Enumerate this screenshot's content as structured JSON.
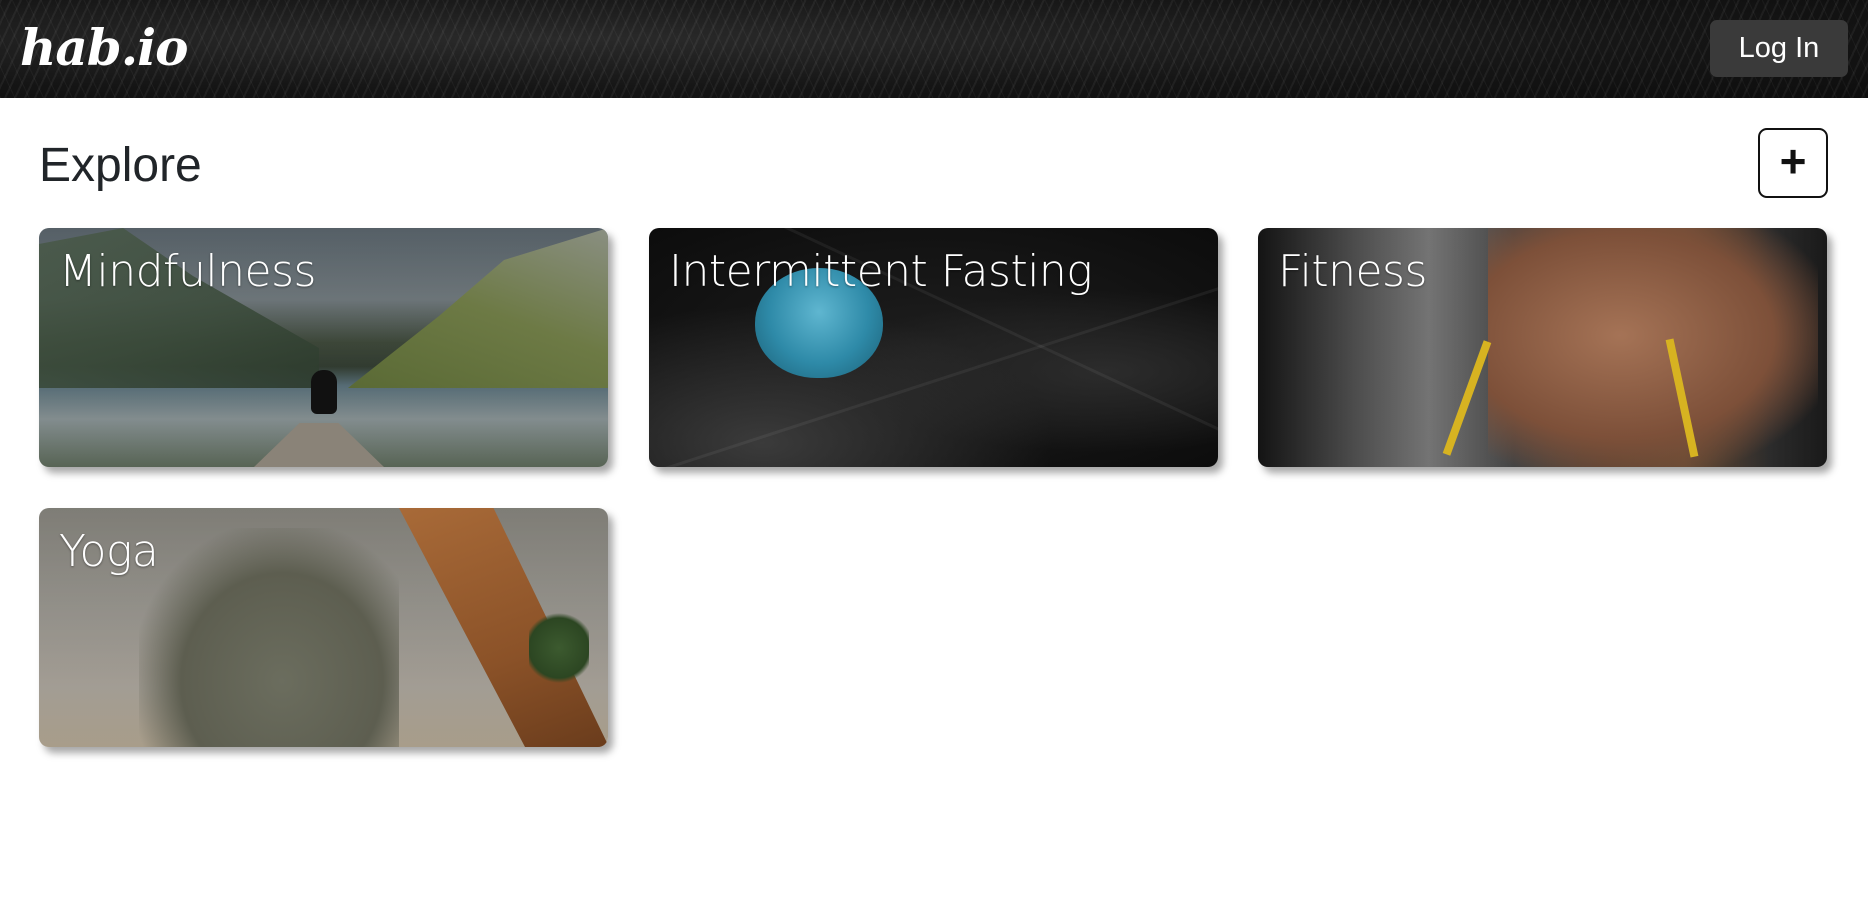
{
  "header": {
    "logo_text": "hab.io",
    "login_label": "Log In"
  },
  "main": {
    "title": "Explore",
    "add_label": "+",
    "cards": [
      {
        "label": "Mindfulness"
      },
      {
        "label": "Intermittent Fasting"
      },
      {
        "label": "Fitness"
      },
      {
        "label": "Yoga"
      }
    ]
  }
}
